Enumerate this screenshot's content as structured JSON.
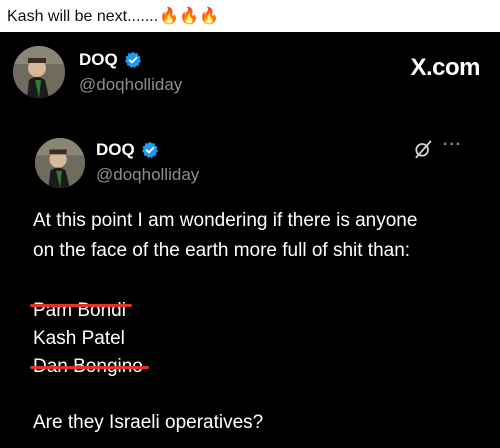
{
  "caption": {
    "text": "Kash will be next.......",
    "emoji": "🔥🔥🔥"
  },
  "outer_post": {
    "display_name": "DOQ",
    "handle": "@doqholliday",
    "brand": "X.com"
  },
  "inner_post": {
    "display_name": "DOQ",
    "handle": "@doqholliday",
    "more": "···",
    "text_line_1": "At this point I am wondering if there is anyone",
    "text_line_2": "on the face of the earth more full of shit than:",
    "names": [
      "Pam Bondi",
      "Kash Patel",
      "Dan Bongino"
    ],
    "question": "Are they Israeli operatives?"
  },
  "colors": {
    "verified": "#1d9bf0",
    "strike": "#e0342c",
    "muted": "#8b8f94",
    "background": "#000000"
  },
  "icons": [
    "verified-badge-icon",
    "grok-icon",
    "more-icon",
    "fire-icon"
  ]
}
